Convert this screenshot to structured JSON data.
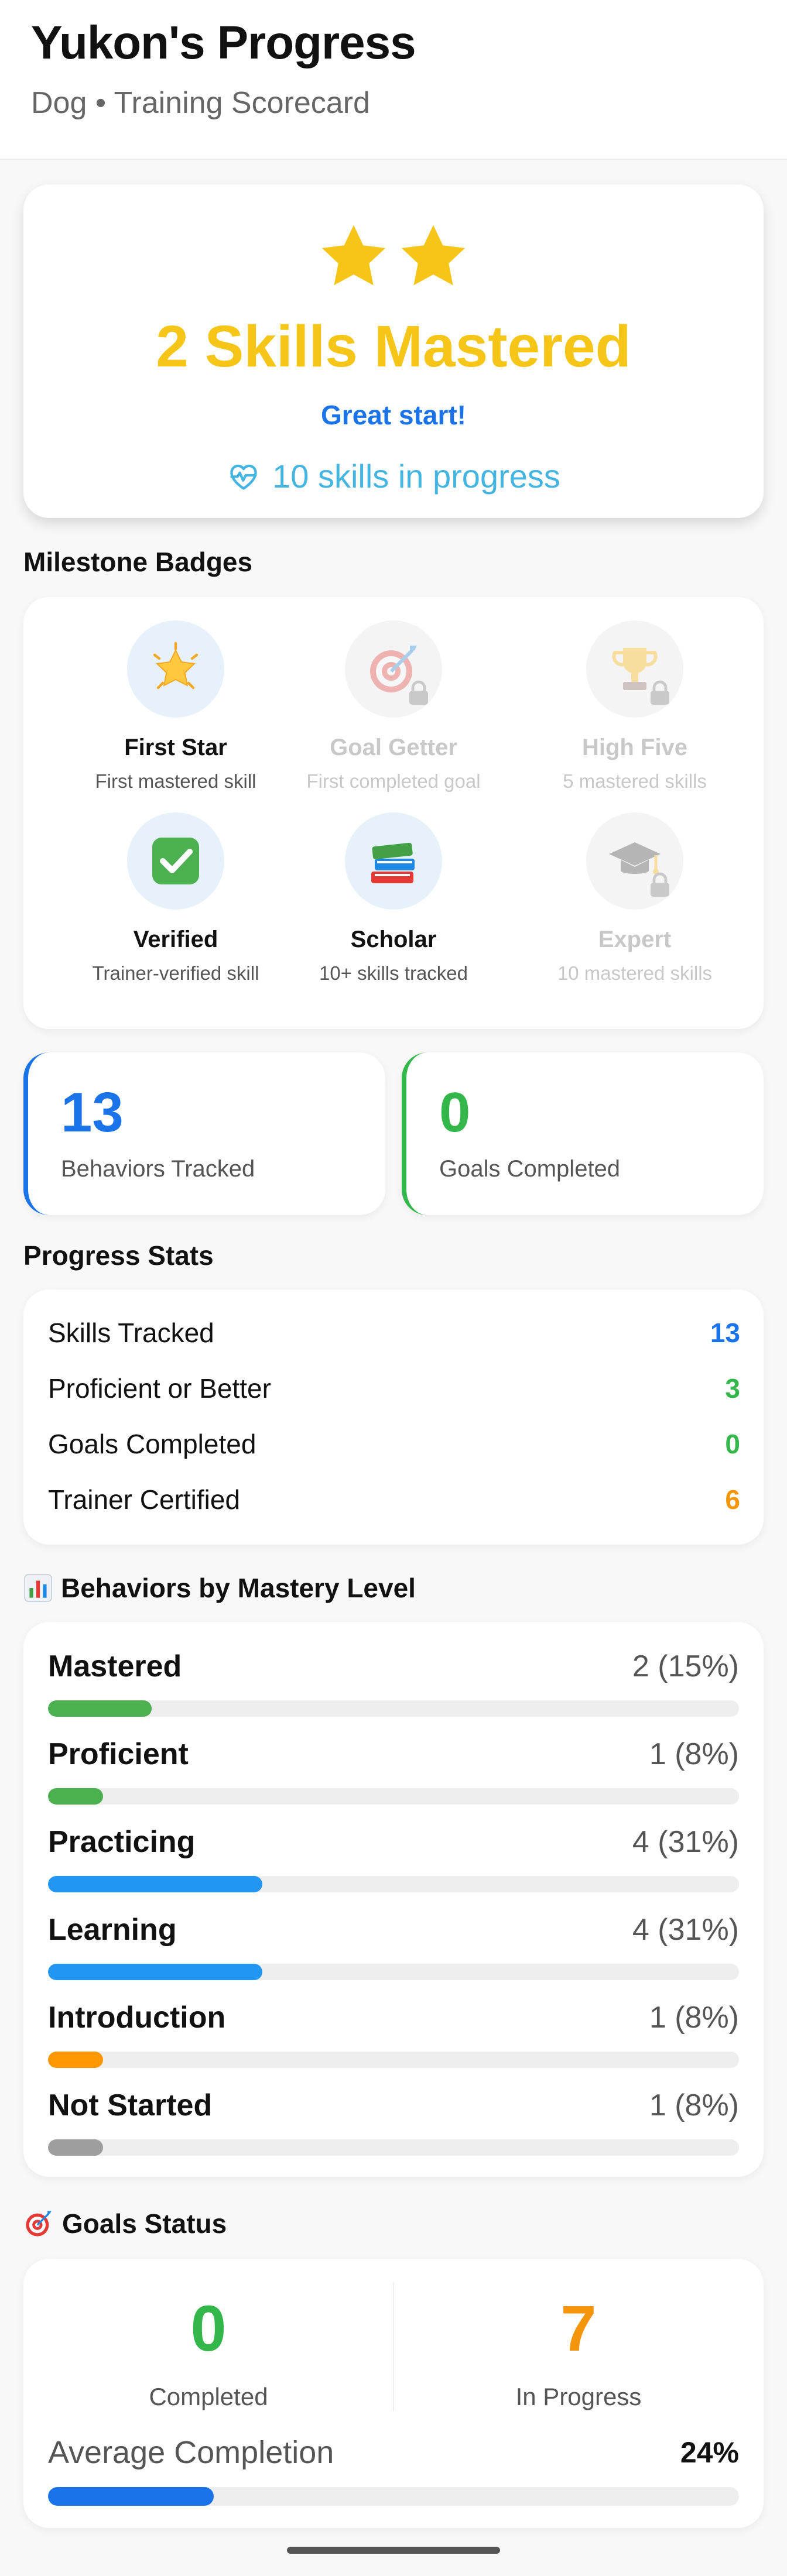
{
  "header": {
    "title": "Yukon's Progress",
    "subtitle": "Dog • Training Scorecard"
  },
  "hero": {
    "stars_icon": "star-icon",
    "mastered_label": "2 Skills Mastered",
    "encouragement": "Great start!",
    "in_progress_label": "10 skills in progress",
    "in_progress_icon": "heart-pulse-icon",
    "accent_color": "#f5c518"
  },
  "milestones": {
    "title": "Milestone Badges",
    "badges": [
      {
        "name": "First Star",
        "desc": "First mastered skill",
        "icon": "glowing-star-icon",
        "locked": false
      },
      {
        "name": "Goal Getter",
        "desc": "First completed goal",
        "icon": "target-icon",
        "locked": true
      },
      {
        "name": "High Five",
        "desc": "5 mastered skills",
        "icon": "trophy-icon",
        "locked": true
      },
      {
        "name": "Verified",
        "desc": "Trainer-verified skill",
        "icon": "check-mark-icon",
        "locked": false
      },
      {
        "name": "Scholar",
        "desc": "10+ skills tracked",
        "icon": "books-icon",
        "locked": false
      },
      {
        "name": "Expert",
        "desc": "10 mastered skills",
        "icon": "graduation-cap-icon",
        "locked": true
      }
    ]
  },
  "summary": {
    "behaviors_tracked": {
      "value": "13",
      "label": "Behaviors Tracked",
      "color": "#1a73e8"
    },
    "goals_completed": {
      "value": "0",
      "label": "Goals Completed",
      "color": "#34b74a"
    }
  },
  "progress_stats": {
    "title": "Progress Stats",
    "rows": [
      {
        "label": "Skills Tracked",
        "value": "13",
        "color": "#1a73e8"
      },
      {
        "label": "Proficient or Better",
        "value": "3",
        "color": "#34b74a"
      },
      {
        "label": "Goals Completed",
        "value": "0",
        "color": "#34b74a"
      },
      {
        "label": "Trainer Certified",
        "value": "6",
        "color": "#f5960a"
      }
    ]
  },
  "mastery": {
    "title": "Behaviors by Mastery Level",
    "title_icon": "bar-chart-icon",
    "levels": [
      {
        "name": "Mastered",
        "value": "2 (15%)",
        "percent": 15,
        "color": "#4caf50"
      },
      {
        "name": "Proficient",
        "value": "1 (8%)",
        "percent": 8,
        "color": "#4caf50"
      },
      {
        "name": "Practicing",
        "value": "4 (31%)",
        "percent": 31,
        "color": "#2196f3"
      },
      {
        "name": "Learning",
        "value": "4 (31%)",
        "percent": 31,
        "color": "#2196f3"
      },
      {
        "name": "Introduction",
        "value": "1 (8%)",
        "percent": 8,
        "color": "#ff9800"
      },
      {
        "name": "Not Started",
        "value": "1 (8%)",
        "percent": 8,
        "color": "#9e9e9e"
      }
    ]
  },
  "goals": {
    "title": "Goals Status",
    "title_icon": "target-icon",
    "completed": {
      "value": "0",
      "label": "Completed",
      "color": "#34b74a"
    },
    "in_progress": {
      "value": "7",
      "label": "In Progress",
      "color": "#f5960a"
    },
    "average_label": "Average Completion",
    "average_value": "24%",
    "average_percent": 24
  }
}
